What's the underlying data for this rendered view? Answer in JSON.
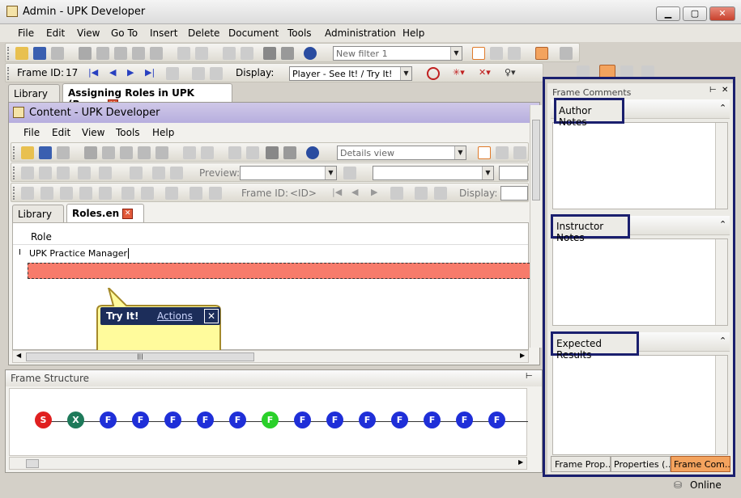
{
  "window": {
    "title": "Admin - UPK Developer",
    "minimize": "▁",
    "maximize": "▢",
    "close": "✕"
  },
  "menu": [
    "File",
    "Edit",
    "View",
    "Go To",
    "Insert",
    "Delete",
    "Document",
    "Tools",
    "Administration",
    "Help"
  ],
  "toolbar1": {
    "filter_value": "New filter 1"
  },
  "toolbar2": {
    "frame_id_label": "Frame ID:",
    "frame_id_value": "17",
    "display_label": "Display:",
    "display_value": "Player - See It! / Try It!"
  },
  "outer_tabs": {
    "library": "Library",
    "active": "Assigning Roles in UPK (Rea..."
  },
  "content_window": {
    "title": "Content - UPK Developer",
    "menu": [
      "File",
      "Edit",
      "View",
      "Tools",
      "Help"
    ],
    "view_value": "Details view",
    "preview_label": "Preview:",
    "frame_id_label": "Frame ID:",
    "frame_id_value": "<ID>",
    "display_label": "Display:",
    "tabs": {
      "library": "Library",
      "active": "Roles.en"
    },
    "grid": {
      "header": "Role",
      "rows": [
        "UPK Practice Manager",
        ""
      ]
    },
    "bubble": {
      "title": "Try It!",
      "actions": "Actions"
    }
  },
  "frame_structure": {
    "title": "Frame Structure",
    "nodes": [
      {
        "label": "S",
        "color": "#e02020"
      },
      {
        "label": "X",
        "color": "#1e7a5a"
      },
      {
        "label": "F",
        "color": "#1f2fd8"
      },
      {
        "label": "F",
        "color": "#1f2fd8"
      },
      {
        "label": "F",
        "color": "#1f2fd8"
      },
      {
        "label": "F",
        "color": "#1f2fd8"
      },
      {
        "label": "F",
        "color": "#1f2fd8"
      },
      {
        "label": "F",
        "color": "#2ad02a"
      },
      {
        "label": "F",
        "color": "#1f2fd8"
      },
      {
        "label": "F",
        "color": "#1f2fd8"
      },
      {
        "label": "F",
        "color": "#1f2fd8"
      },
      {
        "label": "F",
        "color": "#1f2fd8"
      },
      {
        "label": "F",
        "color": "#1f2fd8"
      },
      {
        "label": "F",
        "color": "#1f2fd8"
      },
      {
        "label": "F",
        "color": "#1f2fd8"
      }
    ]
  },
  "frame_comments": {
    "title": "Frame Comments",
    "author_notes": "Author Notes",
    "instructor_notes": "Instructor Notes",
    "expected_results": "Expected Results",
    "bottom_tabs": [
      "Frame Prop...",
      "Properties (...",
      "Frame Com..."
    ]
  },
  "status": {
    "online": "Online"
  },
  "colors": {
    "highlight": "#1a1f6e",
    "selected_row": "#f77b6b",
    "accent_tab": "#f3a35e"
  }
}
